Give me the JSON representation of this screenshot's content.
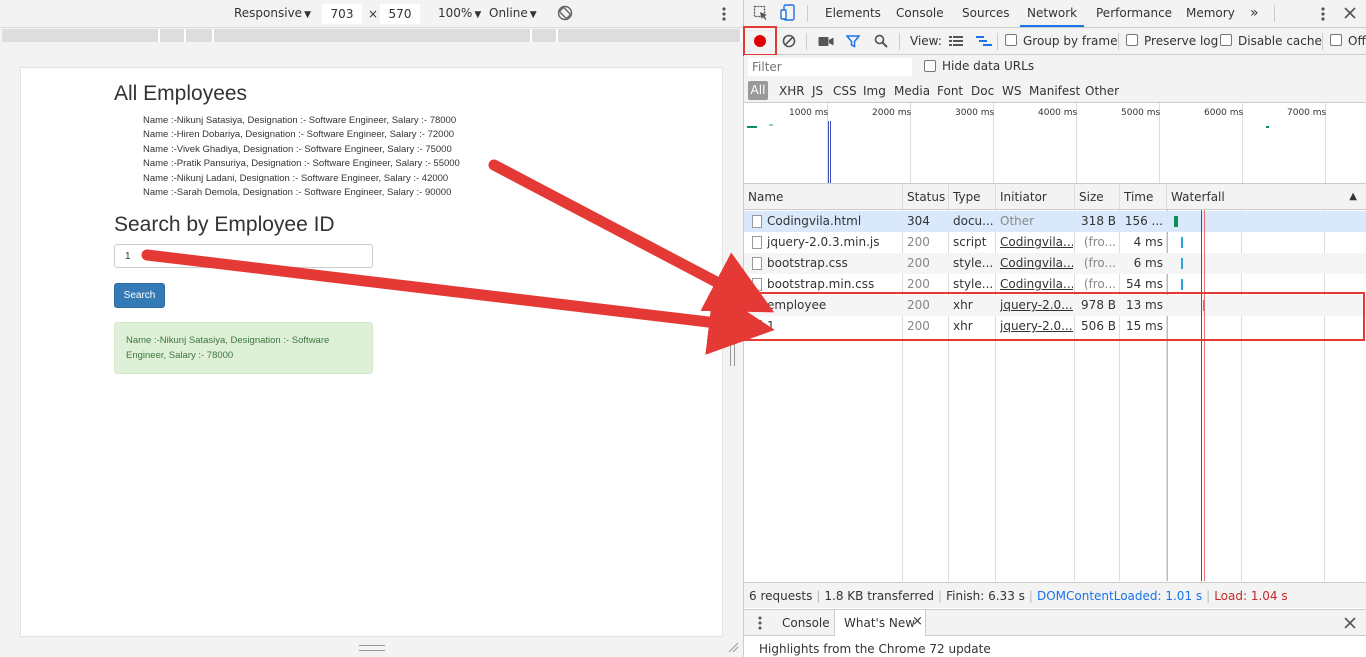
{
  "device_toolbar": {
    "device": "Responsive",
    "width": "703",
    "times": "×",
    "height": "570",
    "zoom": "100%",
    "network": "Online"
  },
  "page": {
    "heading_all": "All Employees",
    "employees": [
      "Name :-Nikunj Satasiya, Designation :- Software Engineer, Salary :- 78000",
      "Name :-Hiren Dobariya, Designation :- Software Engineer, Salary :- 72000",
      "Name :-Vivek Ghadiya, Designation :- Software Engineer, Salary :- 75000",
      "Name :-Pratik Pansuriya, Designation :- Software Engineer, Salary :- 55000",
      "Name :-Nikunj Ladani, Designation :- Software Engineer, Salary :- 42000",
      "Name :-Sarah Demola, Designation :- Software Engineer, Salary :- 90000"
    ],
    "heading_search": "Search by Employee ID",
    "search_value": "1",
    "search_button": "Search",
    "result_text": "Name :-Nikunj Satasiya, Designation :- Software Engineer, Salary :- 78000"
  },
  "devtools": {
    "tabs": [
      "Elements",
      "Console",
      "Sources",
      "Network",
      "Performance",
      "Memory"
    ],
    "more_tabs": "»",
    "active_tab": "Network",
    "toolbar": {
      "view_label": "View:",
      "group_by_frame": "Group by frame",
      "preserve_log": "Preserve log",
      "disable_cache": "Disable cache",
      "offline": "Off"
    },
    "filter_placeholder": "Filter",
    "hide_data_urls": "Hide data URLs",
    "resource_types": [
      "All",
      "XHR",
      "JS",
      "CSS",
      "Img",
      "Media",
      "Font",
      "Doc",
      "WS",
      "Manifest",
      "Other"
    ],
    "overview_ticks": [
      "1000 ms",
      "2000 ms",
      "3000 ms",
      "4000 ms",
      "5000 ms",
      "6000 ms",
      "7000 ms"
    ],
    "columns": [
      "Name",
      "Status",
      "Type",
      "Initiator",
      "Size",
      "Time",
      "Waterfall"
    ],
    "requests": [
      {
        "name": "Codingvila.html",
        "status": "304",
        "type": "docu...",
        "initiator": "Other",
        "size": "318 B",
        "time": "156 ..."
      },
      {
        "name": "jquery-2.0.3.min.js",
        "status": "200",
        "type": "script",
        "initiator": "Codingvila...",
        "size": "(fro...",
        "time": "4 ms"
      },
      {
        "name": "bootstrap.css",
        "status": "200",
        "type": "style...",
        "initiator": "Codingvila...",
        "size": "(fro...",
        "time": "6 ms"
      },
      {
        "name": "bootstrap.min.css",
        "status": "200",
        "type": "style...",
        "initiator": "Codingvila...",
        "size": "(fro...",
        "time": "54 ms"
      },
      {
        "name": "employee",
        "status": "200",
        "type": "xhr",
        "initiator": "jquery-2.0....",
        "size": "978 B",
        "time": "13 ms"
      },
      {
        "name": "1",
        "status": "200",
        "type": "xhr",
        "initiator": "jquery-2.0....",
        "size": "506 B",
        "time": "15 ms"
      }
    ],
    "status_bar": {
      "requests": "6 requests",
      "transferred": "1.8 KB transferred",
      "finish": "Finish: 6.33 s",
      "dom_loaded": "DOMContentLoaded: 1.01 s",
      "load": "Load: 1.04 s"
    },
    "drawer": {
      "tab_console": "Console",
      "tab_whats_new": "What's New",
      "tab_close": "×",
      "body": "Highlights from the Chrome 72 update"
    },
    "colors": {
      "record": "#e00000",
      "annotation": "#e53935",
      "dom_line": "#3f51b5",
      "load_line": "#e57373",
      "active_tab": "#1a73e8"
    }
  }
}
